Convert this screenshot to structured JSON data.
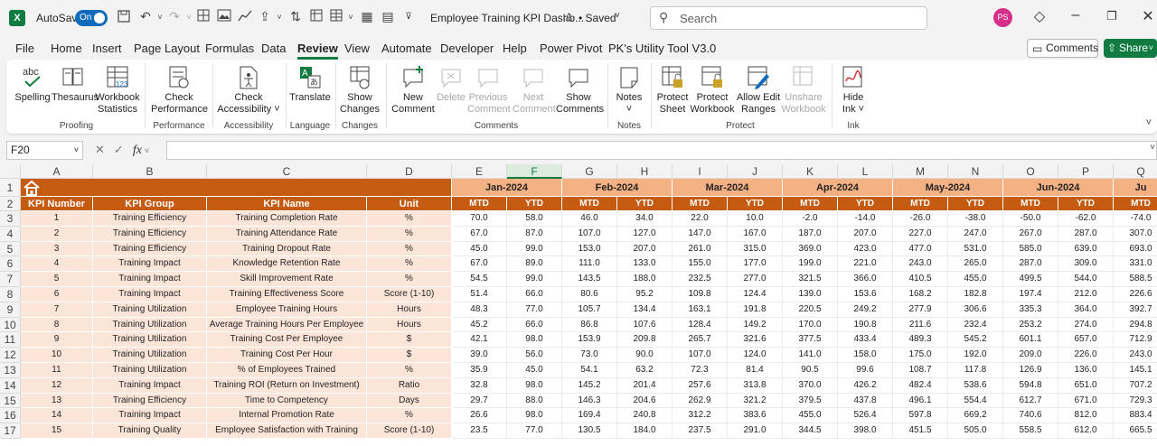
{
  "titlebar": {
    "app_badge": "X",
    "autosave_label": "AutoSave",
    "autosave_state": "On",
    "document_title": "Employee Training KPI Dashb...",
    "save_status": "• Saved",
    "search_placeholder": "Search",
    "user_initials": "PS"
  },
  "menu": {
    "items": [
      "File",
      "Home",
      "Insert",
      "Page Layout",
      "Formulas",
      "Data",
      "Review",
      "View",
      "Automate",
      "Developer",
      "Help",
      "Power Pivot",
      "PK's Utility Tool V3.0"
    ],
    "active": "Review",
    "comments_label": "Comments",
    "share_label": "Share"
  },
  "ribbon": {
    "buttons": [
      {
        "line1": "Spelling",
        "line2": "",
        "icon": "abc-check-icon",
        "enabled": true
      },
      {
        "line1": "Thesaurus",
        "line2": "",
        "icon": "book-icon",
        "enabled": true
      },
      {
        "line1": "Workbook",
        "line2": "Statistics",
        "icon": "statistics-icon",
        "enabled": true
      },
      {
        "line1": "Check",
        "line2": "Performance",
        "icon": "performance-icon",
        "enabled": true
      },
      {
        "line1": "Check",
        "line2": "Accessibility ˅",
        "icon": "accessibility-icon",
        "enabled": true
      },
      {
        "line1": "Translate",
        "line2": "",
        "icon": "translate-icon",
        "enabled": true
      },
      {
        "line1": "Show",
        "line2": "Changes",
        "icon": "changes-icon",
        "enabled": true
      },
      {
        "line1": "New",
        "line2": "Comment",
        "icon": "new-comment-icon",
        "enabled": true
      },
      {
        "line1": "Delete",
        "line2": "",
        "icon": "delete-comment-icon",
        "enabled": false
      },
      {
        "line1": "Previous",
        "line2": "Comment",
        "icon": "previous-comment-icon",
        "enabled": false
      },
      {
        "line1": "Next",
        "line2": "Comment",
        "icon": "next-comment-icon",
        "enabled": false
      },
      {
        "line1": "Show",
        "line2": "Comments",
        "icon": "show-comments-icon",
        "enabled": true
      },
      {
        "line1": "Notes",
        "line2": "˅",
        "icon": "notes-icon",
        "enabled": true
      },
      {
        "line1": "Protect",
        "line2": "Sheet",
        "icon": "protect-sheet-icon",
        "enabled": true
      },
      {
        "line1": "Protect",
        "line2": "Workbook",
        "icon": "protect-workbook-icon",
        "enabled": true
      },
      {
        "line1": "Allow Edit",
        "line2": "Ranges",
        "icon": "allow-edit-icon",
        "enabled": true
      },
      {
        "line1": "Unshare",
        "line2": "Workbook",
        "icon": "unshare-icon",
        "enabled": false
      },
      {
        "line1": "Hide",
        "line2": "Ink ˅",
        "icon": "ink-icon",
        "enabled": true
      }
    ],
    "groups": [
      "Proofing",
      "Performance",
      "Accessibility",
      "Language",
      "Changes",
      "Comments",
      "Notes",
      "Protect",
      "Ink"
    ]
  },
  "formula_bar": {
    "name_box": "F20",
    "fx": "fx",
    "value": ""
  },
  "sheet": {
    "columns": [
      "A",
      "B",
      "C",
      "D",
      "E",
      "F",
      "G",
      "H",
      "I",
      "J",
      "K",
      "L",
      "M",
      "N",
      "O",
      "P",
      "Q"
    ],
    "selected_column": "F",
    "row_numbers": [
      "1",
      "2",
      "3",
      "4",
      "5",
      "6",
      "7",
      "8",
      "9",
      "10",
      "11",
      "12",
      "13",
      "14",
      "15",
      "16",
      "17"
    ],
    "months": [
      "Jan-2024",
      "Feb-2024",
      "Mar-2024",
      "Apr-2024",
      "May-2024",
      "Jun-2024",
      "Ju"
    ],
    "headers": [
      "KPI Number",
      "KPI Group",
      "KPI Name",
      "Unit"
    ],
    "sub_headers": [
      "MTD",
      "YTD"
    ],
    "rows": [
      [
        "1",
        "Training Efficiency",
        "Training Completion Rate",
        "%",
        "70.0",
        "58.0",
        "46.0",
        "34.0",
        "22.0",
        "10.0",
        "-2.0",
        "-14.0",
        "-26.0",
        "-38.0",
        "-50.0",
        "-62.0",
        "-74.0"
      ],
      [
        "2",
        "Training Efficiency",
        "Training Attendance Rate",
        "%",
        "67.0",
        "87.0",
        "107.0",
        "127.0",
        "147.0",
        "167.0",
        "187.0",
        "207.0",
        "227.0",
        "247.0",
        "267.0",
        "287.0",
        "307.0"
      ],
      [
        "3",
        "Training Efficiency",
        "Training Dropout Rate",
        "%",
        "45.0",
        "99.0",
        "153.0",
        "207.0",
        "261.0",
        "315.0",
        "369.0",
        "423.0",
        "477.0",
        "531.0",
        "585.0",
        "639.0",
        "693.0"
      ],
      [
        "4",
        "Training Impact",
        "Knowledge Retention Rate",
        "%",
        "67.0",
        "89.0",
        "111.0",
        "133.0",
        "155.0",
        "177.0",
        "199.0",
        "221.0",
        "243.0",
        "265.0",
        "287.0",
        "309.0",
        "331.0"
      ],
      [
        "5",
        "Training Impact",
        "Skill Improvement Rate",
        "%",
        "54.5",
        "99.0",
        "143.5",
        "188.0",
        "232.5",
        "277.0",
        "321.5",
        "366.0",
        "410.5",
        "455.0",
        "499.5",
        "544.0",
        "588.5"
      ],
      [
        "6",
        "Training Impact",
        "Training Effectiveness Score",
        "Score (1-10)",
        "51.4",
        "66.0",
        "80.6",
        "95.2",
        "109.8",
        "124.4",
        "139.0",
        "153.6",
        "168.2",
        "182.8",
        "197.4",
        "212.0",
        "226.6"
      ],
      [
        "7",
        "Training Utilization",
        "Employee Training Hours",
        "Hours",
        "48.3",
        "77.0",
        "105.7",
        "134.4",
        "163.1",
        "191.8",
        "220.5",
        "249.2",
        "277.9",
        "306.6",
        "335.3",
        "364.0",
        "392.7"
      ],
      [
        "8",
        "Training Utilization",
        "Average Training Hours Per Employee",
        "Hours",
        "45.2",
        "66.0",
        "86.8",
        "107.6",
        "128.4",
        "149.2",
        "170.0",
        "190.8",
        "211.6",
        "232.4",
        "253.2",
        "274.0",
        "294.8"
      ],
      [
        "9",
        "Training Utilization",
        "Training Cost Per Employee",
        "$",
        "42.1",
        "98.0",
        "153.9",
        "209.8",
        "265.7",
        "321.6",
        "377.5",
        "433.4",
        "489.3",
        "545.2",
        "601.1",
        "657.0",
        "712.9"
      ],
      [
        "10",
        "Training Utilization",
        "Training Cost Per Hour",
        "$",
        "39.0",
        "56.0",
        "73.0",
        "90.0",
        "107.0",
        "124.0",
        "141.0",
        "158.0",
        "175.0",
        "192.0",
        "209.0",
        "226.0",
        "243.0"
      ],
      [
        "11",
        "Training Utilization",
        "% of Employees Trained",
        "%",
        "35.9",
        "45.0",
        "54.1",
        "63.2",
        "72.3",
        "81.4",
        "90.5",
        "99.6",
        "108.7",
        "117.8",
        "126.9",
        "136.0",
        "145.1"
      ],
      [
        "12",
        "Training Impact",
        "Training ROI (Return on Investment)",
        "Ratio",
        "32.8",
        "98.0",
        "145.2",
        "201.4",
        "257.6",
        "313.8",
        "370.0",
        "426.2",
        "482.4",
        "538.6",
        "594.8",
        "651.0",
        "707.2"
      ],
      [
        "13",
        "Training Efficiency",
        "Time to Competency",
        "Days",
        "29.7",
        "88.0",
        "146.3",
        "204.6",
        "262.9",
        "321.2",
        "379.5",
        "437.8",
        "496.1",
        "554.4",
        "612.7",
        "671.0",
        "729.3"
      ],
      [
        "14",
        "Training Impact",
        "Internal Promotion Rate",
        "%",
        "26.6",
        "98.0",
        "169.4",
        "240.8",
        "312.2",
        "383.6",
        "455.0",
        "526.4",
        "597.8",
        "669.2",
        "740.6",
        "812.0",
        "883.4"
      ],
      [
        "15",
        "Training Quality",
        "Employee Satisfaction with Training",
        "Score (1-10)",
        "23.5",
        "77.0",
        "130.5",
        "184.0",
        "237.5",
        "291.0",
        "344.5",
        "398.0",
        "451.5",
        "505.0",
        "558.5",
        "612.0",
        "665.5"
      ]
    ]
  }
}
